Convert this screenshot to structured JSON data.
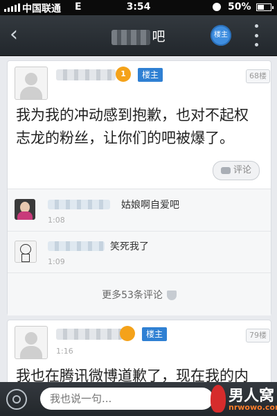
{
  "status_bar": {
    "carrier": "中国联通",
    "network": "E",
    "time": "3:54",
    "battery": "50%"
  },
  "nav": {
    "back_icon": "chevron-left-icon",
    "title_visible": "吧",
    "badge_label": "楼主",
    "more_icon": "more-vertical-icon"
  },
  "posts": [
    {
      "owner_label": "楼主",
      "floor": "68楼",
      "text": "我为我的冲动感到抱歉，也对不起权志龙的粉丝，让你们的吧被爆了。",
      "comment_button": "评论",
      "replies": [
        {
          "text": "姑娘啊自爱吧",
          "time": "1:08"
        },
        {
          "text": "笑死我了",
          "time": "1:09"
        }
      ],
      "more_comments": "更多53条评论"
    },
    {
      "owner_label": "楼主",
      "floor": "79楼",
      "text": "我也在腾讯微博道歉了，现在我的内",
      "time": "1:16"
    }
  ],
  "bottom_bar": {
    "input_placeholder": "我也说一句...",
    "watermark_cn": "男人窝",
    "watermark_en": "nrwowo.com"
  },
  "colors": {
    "owner_badge": "#2f80d3",
    "crown": "#f4a21a",
    "nav_bg": "#2b3035"
  }
}
